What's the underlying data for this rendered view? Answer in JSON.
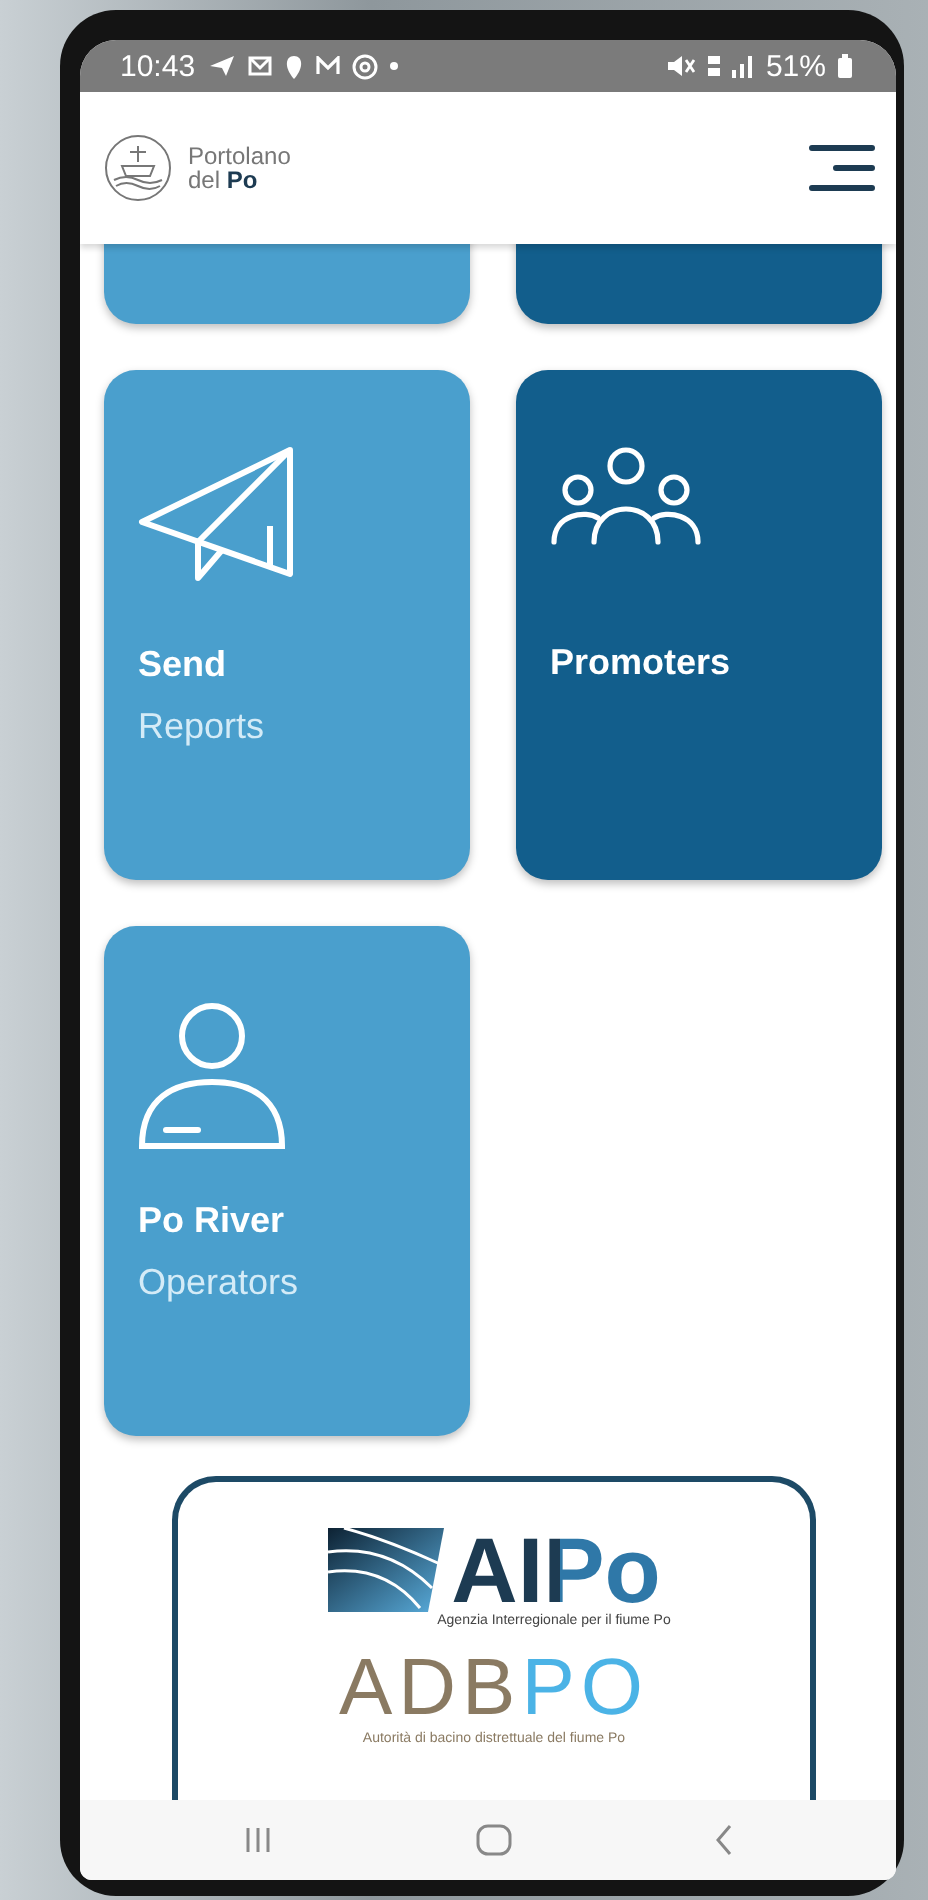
{
  "status_bar": {
    "time": "10:43",
    "battery": "51%"
  },
  "header": {
    "app_name": "Portolano",
    "app_name_2": "del **Po**"
  },
  "tiles": [
    {
      "kind": "blank",
      "color": "#4a9fcd"
    },
    {
      "kind": "blank",
      "color": "#125e8c"
    },
    {
      "kind": "send",
      "color": "#4a9fcd",
      "title": "Send",
      "subtitle": "Reports"
    },
    {
      "kind": "people",
      "color": "#125e8c",
      "title": "Promoters"
    },
    {
      "kind": "person",
      "color": "#4a9fcd",
      "title": "Po River",
      "subtitle": "Operators"
    }
  ],
  "partners": [
    {
      "kind": "aipo",
      "name": "AIPo",
      "caption": "Agenzia Interregionale per il fiume Po"
    },
    {
      "kind": "adbpo",
      "name": "ADBPO",
      "caption": "Autorità di bacino distrettuale del fiume Po"
    }
  ]
}
